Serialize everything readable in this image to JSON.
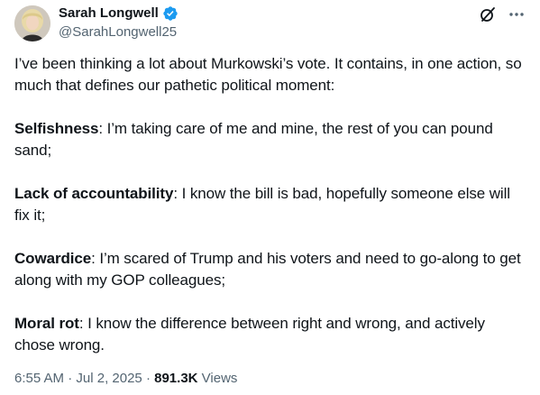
{
  "author": {
    "display_name": "Sarah Longwell",
    "handle": "@SarahLongwell25",
    "verified": true
  },
  "colors": {
    "verified_badge": "#1d9bf0",
    "primary_text": "#0f1419",
    "secondary_text": "#536471"
  },
  "icons": {
    "verified": "verified-badge-icon",
    "grok": "grok-icon",
    "more": "more-icon"
  },
  "post": {
    "intro": "I’ve been thinking a lot about Murkowski’s vote. It contains, in one action, so much that defines our pathetic political moment:",
    "points": [
      {
        "label": "Selfishness",
        "text": ": I’m taking care of me and mine, the rest of you can pound sand;"
      },
      {
        "label": "Lack of accountability",
        "text": ": I know the bill is bad, hopefully someone else will fix it;"
      },
      {
        "label": "Cowardice",
        "text": ": I’m scared of Trump and his voters and need to go-along to get along with my GOP colleagues;"
      },
      {
        "label": "Moral rot",
        "text": ": I know the difference between right and wrong, and actively chose wrong."
      }
    ]
  },
  "meta": {
    "time": "6:55 AM",
    "separator": "·",
    "date": "Jul 2, 2025",
    "views_count": "891.3K",
    "views_label": "Views"
  }
}
